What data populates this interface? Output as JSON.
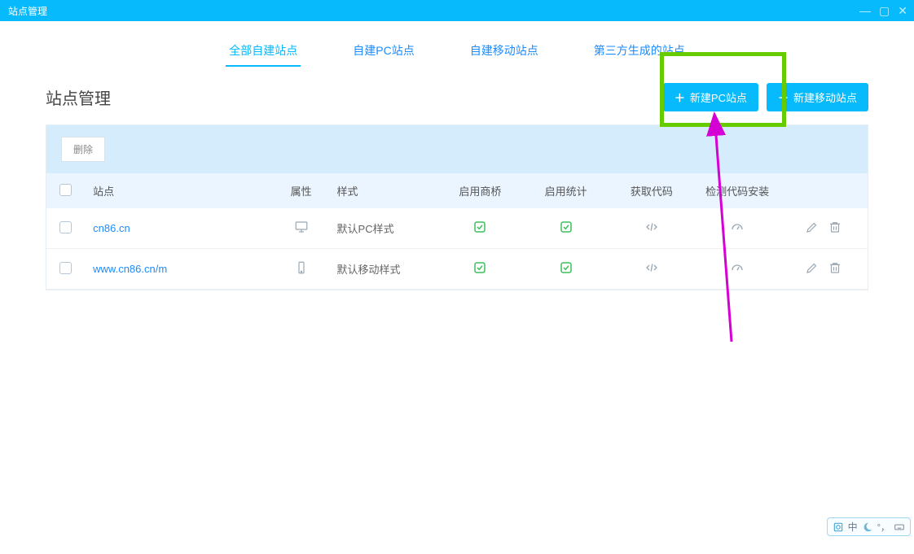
{
  "window": {
    "title": "站点管理"
  },
  "tabs": [
    {
      "label": "全部自建站点",
      "active": true
    },
    {
      "label": "自建PC站点",
      "active": false
    },
    {
      "label": "自建移动站点",
      "active": false
    },
    {
      "label": "第三方生成的站点",
      "active": false
    }
  ],
  "section": {
    "heading": "站点管理",
    "new_pc_label": "新建PC站点",
    "new_mobile_label": "新建移动站点"
  },
  "toolbar": {
    "delete_label": "删除"
  },
  "table": {
    "headers": {
      "site": "站点",
      "attr": "属性",
      "style": "样式",
      "enable_bridge": "启用商桥",
      "enable_stats": "启用统计",
      "get_code": "获取代码",
      "check_install": "检测代码安装"
    },
    "rows": [
      {
        "site": "cn86.cn",
        "device": "desktop",
        "style": "默认PC样式",
        "bridge": true,
        "stats": true
      },
      {
        "site": "www.cn86.cn/m",
        "device": "mobile",
        "style": "默认移动样式",
        "bridge": true,
        "stats": true
      }
    ]
  },
  "ime": {
    "lang": "中"
  },
  "annotation": {
    "highlight_target": "new-pc-button"
  }
}
